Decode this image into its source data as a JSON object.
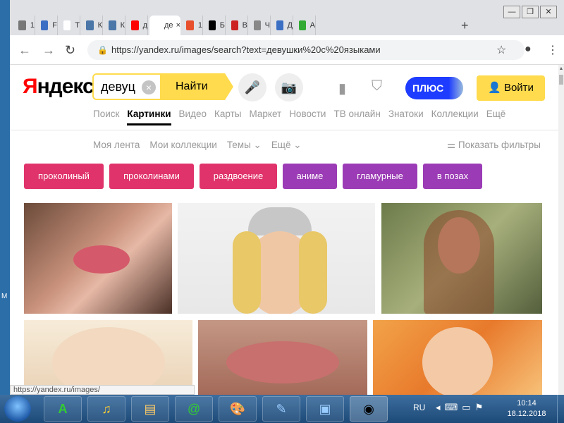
{
  "browser": {
    "window_controls": [
      "—",
      "❐",
      "✕"
    ],
    "tabs": [
      {
        "label": "1",
        "icon": "document-icon",
        "color": "#777"
      },
      {
        "label": "F",
        "icon": "pause-icon",
        "color": "#3b6fc4"
      },
      {
        "label": "T",
        "icon": "wikipedia-icon",
        "color": "#fff"
      },
      {
        "label": "К",
        "icon": "vk-icon",
        "color": "#4a76a8"
      },
      {
        "label": "К",
        "icon": "vk-icon",
        "color": "#4a76a8"
      },
      {
        "label": "д",
        "icon": "yandex-icon",
        "color": "#f00"
      },
      {
        "label": "де",
        "icon": "yandex-images-icon",
        "color": "#fff",
        "active": true
      },
      {
        "label": "1",
        "icon": "news-icon",
        "color": "#e8502d"
      },
      {
        "label": "Б",
        "icon": "runner-icon",
        "color": "#000"
      },
      {
        "label": "В",
        "icon": "red-badge-icon",
        "color": "#c22"
      },
      {
        "label": "Ч",
        "icon": "person-icon",
        "color": "#888"
      },
      {
        "label": "Д",
        "icon": "chat-icon",
        "color": "#3b6fc4"
      },
      {
        "label": "А",
        "icon": "green-square-icon",
        "color": "#3a3"
      }
    ],
    "new_tab": "+",
    "url": "https://yandex.ru/images/search?text=девушки%20с%20языками",
    "hover_url": "https://yandex.ru/images/"
  },
  "yandex": {
    "logo": "Яндекс",
    "search_query": "девуц",
    "find_label": "Найти",
    "plus_label": "ПЛЮС",
    "login_label": "Войти",
    "services": [
      "Поиск",
      "Картинки",
      "Видео",
      "Карты",
      "Маркет",
      "Новости",
      "ТВ онлайн",
      "Знатоки",
      "Коллекции",
      "Ещё"
    ],
    "active_service": "Картинки",
    "subnav": [
      "Моя лента",
      "Мои коллекции",
      "Темы ⌄",
      "Ещё ⌄"
    ],
    "filters_label": "Показать фильтры",
    "chips": [
      {
        "label": "проколиный",
        "color": "#e0336b"
      },
      {
        "label": "проколинами",
        "color": "#e0336b"
      },
      {
        "label": "раздвоение",
        "color": "#e0336b"
      },
      {
        "label": "аниме",
        "color": "#9b3bb5"
      },
      {
        "label": "гламурные",
        "color": "#9b3bb5"
      },
      {
        "label": "в позах",
        "color": "#9b3bb5"
      }
    ]
  },
  "taskbar": {
    "lang": "RU",
    "time": "10:14",
    "date": "18.12.2018"
  }
}
